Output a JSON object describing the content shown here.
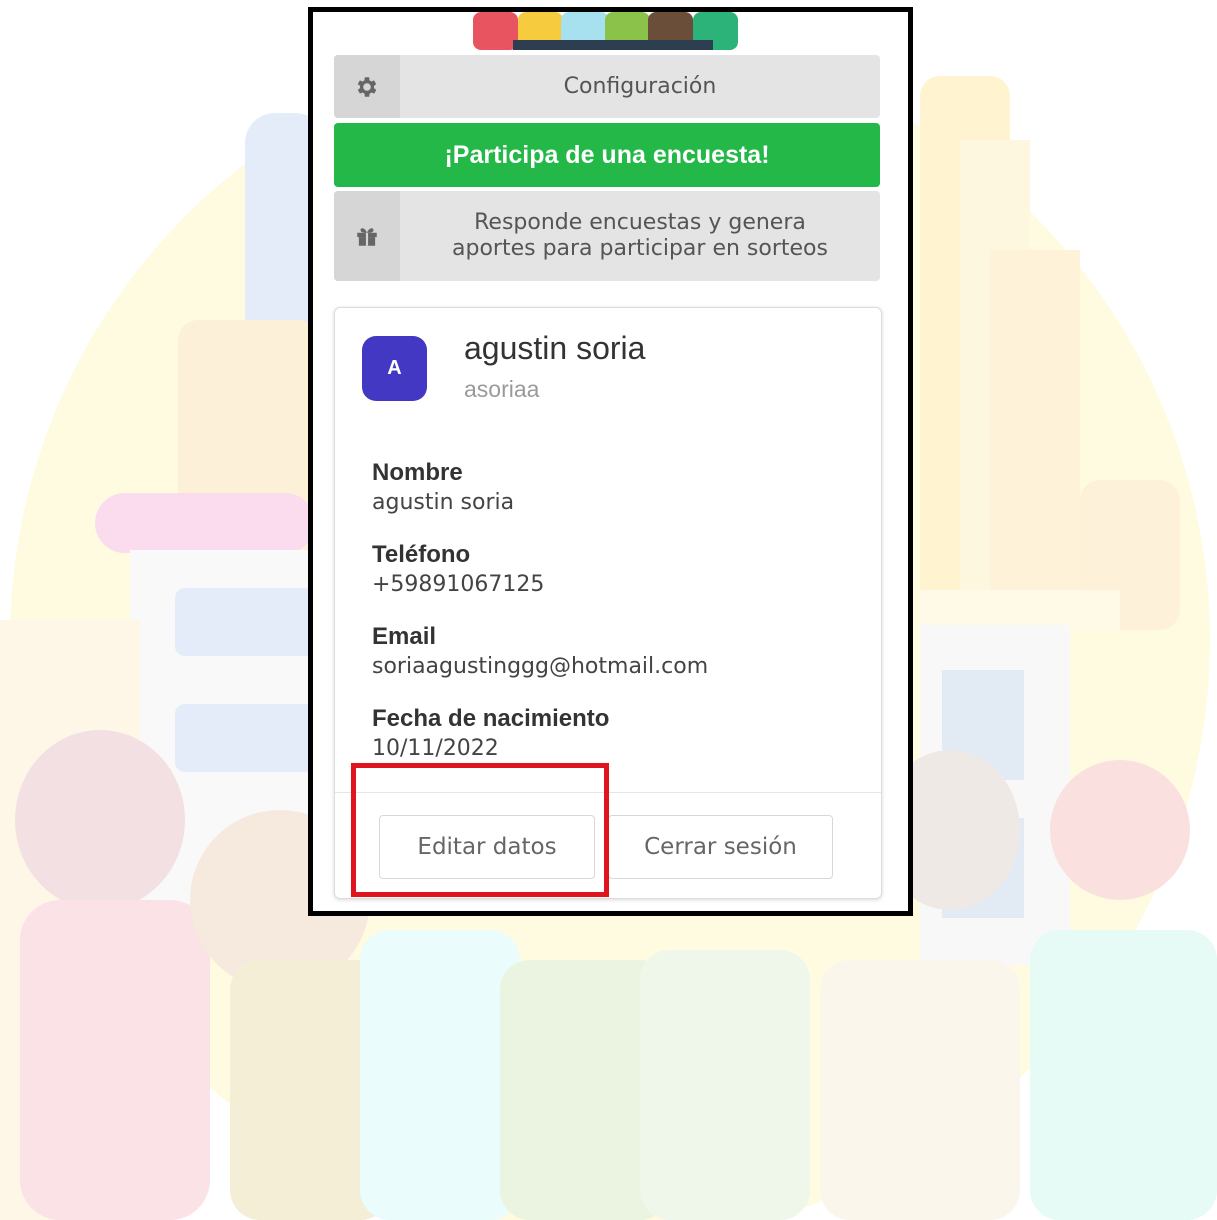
{
  "menu": {
    "config_label": "Configuración",
    "config_icon": "gear-icon",
    "survey_button": "¡Participa de una encuesta!",
    "raffle_line1": "Responde encuestas y genera",
    "raffle_line2": "aportes para participar en sorteos",
    "raffle_icon": "gift-icon"
  },
  "profile": {
    "avatar_initial": "A",
    "name": "agustin soria",
    "username": "asoriaa",
    "fields": [
      {
        "label": "Nombre",
        "value": "agustin soria"
      },
      {
        "label": "Teléfono",
        "value": "+59891067125"
      },
      {
        "label": "Email",
        "value": "soriaagustinggg@hotmail.com"
      },
      {
        "label": "Fecha de nacimiento",
        "value": "10/11/2022"
      }
    ]
  },
  "actions": {
    "edit_label": "Editar datos",
    "logout_label": "Cerrar sesión"
  },
  "colors": {
    "survey_green": "#23b847",
    "avatar_purple": "#4338c3",
    "highlight_red": "#e0141e"
  }
}
